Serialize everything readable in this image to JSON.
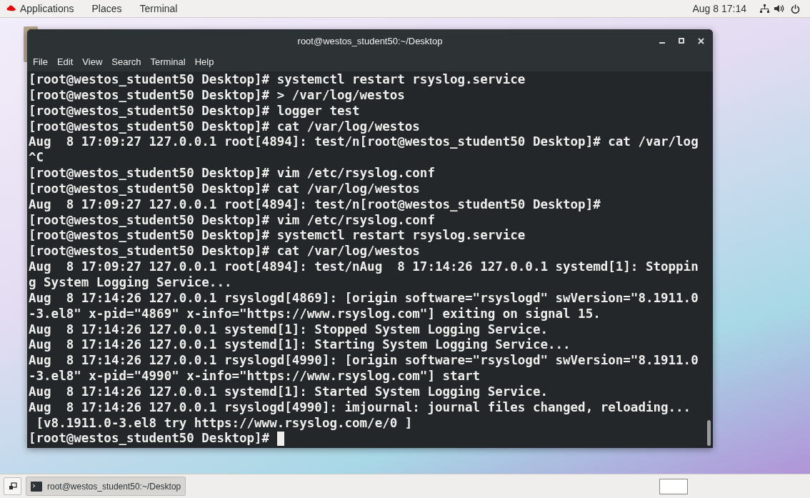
{
  "top_bar": {
    "menus": [
      "Applications",
      "Places",
      "Terminal"
    ],
    "clock": "Aug 8  17:14"
  },
  "window": {
    "title": "root@westos_student50:~/Desktop",
    "controls": [
      {
        "kind": "minimize"
      },
      {
        "kind": "maximize"
      },
      {
        "kind": "close"
      }
    ],
    "menu": [
      "File",
      "Edit",
      "View",
      "Search",
      "Terminal",
      "Help"
    ],
    "lines": [
      "[root@westos_student50 Desktop]# systemctl restart rsyslog.service",
      "[root@westos_student50 Desktop]# > /var/log/westos",
      "[root@westos_student50 Desktop]# logger test",
      "[root@westos_student50 Desktop]# cat /var/log/westos",
      "Aug  8 17:09:27 127.0.0.1 root[4894]: test/n[root@westos_student50 Desktop]# cat /var/log",
      "^C",
      "[root@westos_student50 Desktop]# vim /etc/rsyslog.conf",
      "[root@westos_student50 Desktop]# cat /var/log/westos",
      "Aug  8 17:09:27 127.0.0.1 root[4894]: test/n[root@westos_student50 Desktop]#",
      "[root@westos_student50 Desktop]# vim /etc/rsyslog.conf",
      "[root@westos_student50 Desktop]# systemctl restart rsyslog.service",
      "[root@westos_student50 Desktop]# cat /var/log/westos",
      "Aug  8 17:09:27 127.0.0.1 root[4894]: test/nAug  8 17:14:26 127.0.0.1 systemd[1]: Stoppin",
      "g System Logging Service...",
      "Aug  8 17:14:26 127.0.0.1 rsyslogd[4869]: [origin software=\"rsyslogd\" swVersion=\"8.1911.0",
      "-3.el8\" x-pid=\"4869\" x-info=\"https://www.rsyslog.com\"] exiting on signal 15.",
      "Aug  8 17:14:26 127.0.0.1 systemd[1]: Stopped System Logging Service.",
      "Aug  8 17:14:26 127.0.0.1 systemd[1]: Starting System Logging Service...",
      "Aug  8 17:14:26 127.0.0.1 rsyslogd[4990]: [origin software=\"rsyslogd\" swVersion=\"8.1911.0",
      "-3.el8\" x-pid=\"4990\" x-info=\"https://www.rsyslog.com\"] start",
      "Aug  8 17:14:26 127.0.0.1 systemd[1]: Started System Logging Service.",
      "Aug  8 17:14:26 127.0.0.1 rsyslogd[4990]: imjournal: journal files changed, reloading...",
      " [v8.1911.0-3.el8 try https://www.rsyslog.com/e/0 ]"
    ],
    "prompt": "[root@westos_student50 Desktop]# "
  },
  "taskbar": {
    "tasks": [
      {
        "label": "root@westos_student50:~/Desktop",
        "selected": true
      }
    ]
  }
}
